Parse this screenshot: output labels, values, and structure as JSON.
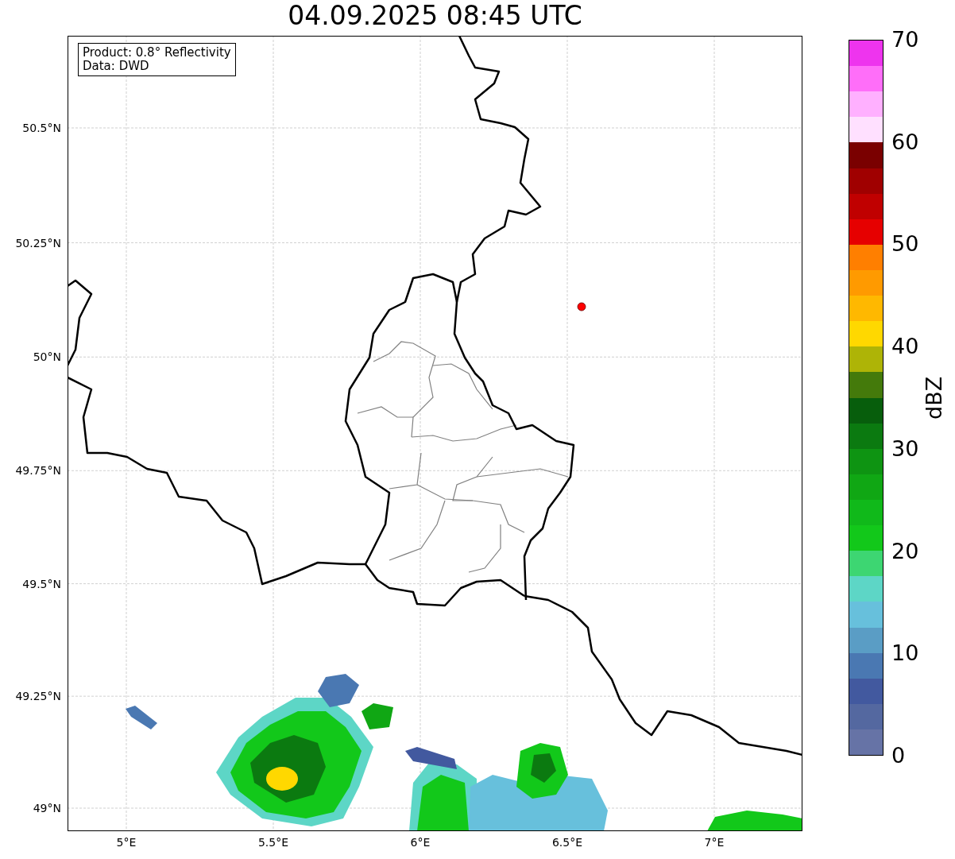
{
  "title": "04.09.2025 08:45 UTC",
  "map": {
    "info_box": [
      "Product: 0.8° Reflectivity",
      "Data: DWD"
    ],
    "xticks": [
      "5°E",
      "5.5°E",
      "6°E",
      "6.5°E",
      "7°E"
    ],
    "yticks": [
      "50.5°N",
      "50.25°N",
      "50°N",
      "49.75°N",
      "49.5°N",
      "49.25°N",
      "49°N"
    ]
  },
  "colorbar": {
    "label": "dBZ",
    "ticks": [
      "70",
      "60",
      "50",
      "40",
      "30",
      "20",
      "10",
      "0"
    ],
    "bands": [
      {
        "color": "#ee34ee"
      },
      {
        "color": "#ff6ef9"
      },
      {
        "color": "#ffb0ff"
      },
      {
        "color": "#ffe0ff"
      },
      {
        "color": "#7a0000"
      },
      {
        "color": "#a00000"
      },
      {
        "color": "#c00000"
      },
      {
        "color": "#e60000"
      },
      {
        "color": "#ff7f00"
      },
      {
        "color": "#ff9a00"
      },
      {
        "color": "#ffb800"
      },
      {
        "color": "#ffd800"
      },
      {
        "color": "#aeb406"
      },
      {
        "color": "#447a0b"
      },
      {
        "color": "#075e0c"
      },
      {
        "color": "#0b7a10"
      },
      {
        "color": "#0e9412"
      },
      {
        "color": "#10a714"
      },
      {
        "color": "#10b91a"
      },
      {
        "color": "#12c81a"
      },
      {
        "color": "#3dd672"
      },
      {
        "color": "#5dd6c6"
      },
      {
        "color": "#67c0dc"
      },
      {
        "color": "#5a9dc5"
      },
      {
        "color": "#4a78b2"
      },
      {
        "color": "#42599f"
      },
      {
        "color": "#5468a0"
      },
      {
        "color": "#6673a6"
      }
    ]
  }
}
